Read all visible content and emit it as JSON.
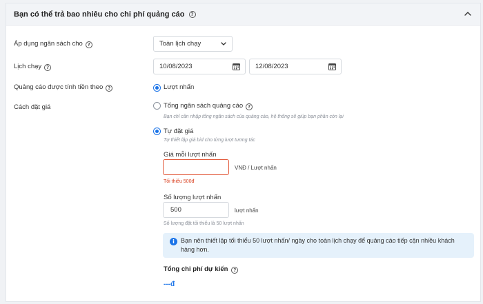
{
  "section": {
    "title": "Bạn có thể trả bao nhiêu cho chi phí quảng cáo",
    "help_icon": "question-circle-icon",
    "collapse_icon": "chevron-up-icon"
  },
  "budget_apply": {
    "label": "Áp dụng ngân sách cho",
    "selected": "Toàn lịch chạy"
  },
  "schedule": {
    "label": "Lịch chạy",
    "start_date": "10/08/2023",
    "end_date": "12/08/2023"
  },
  "charge_basis": {
    "label": "Quảng cáo được tính tiền theo",
    "option": "Lượt nhấn"
  },
  "bidding": {
    "label": "Cách đặt giá",
    "total_budget": {
      "label": "Tổng ngân sách quảng cáo",
      "hint": "Bạn chỉ cần nhập tổng ngân sách của quảng cáo, hệ thống sẽ giúp bạn phần còn lại"
    },
    "manual": {
      "label": "Tự đặt giá",
      "hint": "Tự thiết lập giá bid cho từng lượt tương tác"
    }
  },
  "price_per_click": {
    "label": "Giá mỗi lượt nhấn",
    "value": "",
    "unit": "VNĐ / Lượt nhấn",
    "error": "Tối thiểu 500đ"
  },
  "click_count": {
    "label": "Số lượng lượt nhấn",
    "value": "500",
    "unit": "lượt nhấn",
    "note": "Số lượng đặt tối thiểu là 50 lượt nhấn"
  },
  "info_banner": {
    "text": "Bạn nên thiết lập tối thiểu 50 lượt nhấn/ ngày cho toàn lịch chạy để quảng cáo tiếp cận nhiều khách hàng hơn."
  },
  "estimate": {
    "label": "Tổng chi phí dự kiến",
    "value": "---đ"
  },
  "colors": {
    "accent": "#1a73e8",
    "error": "#d93b1a",
    "info_bg": "#e5f1fb"
  }
}
